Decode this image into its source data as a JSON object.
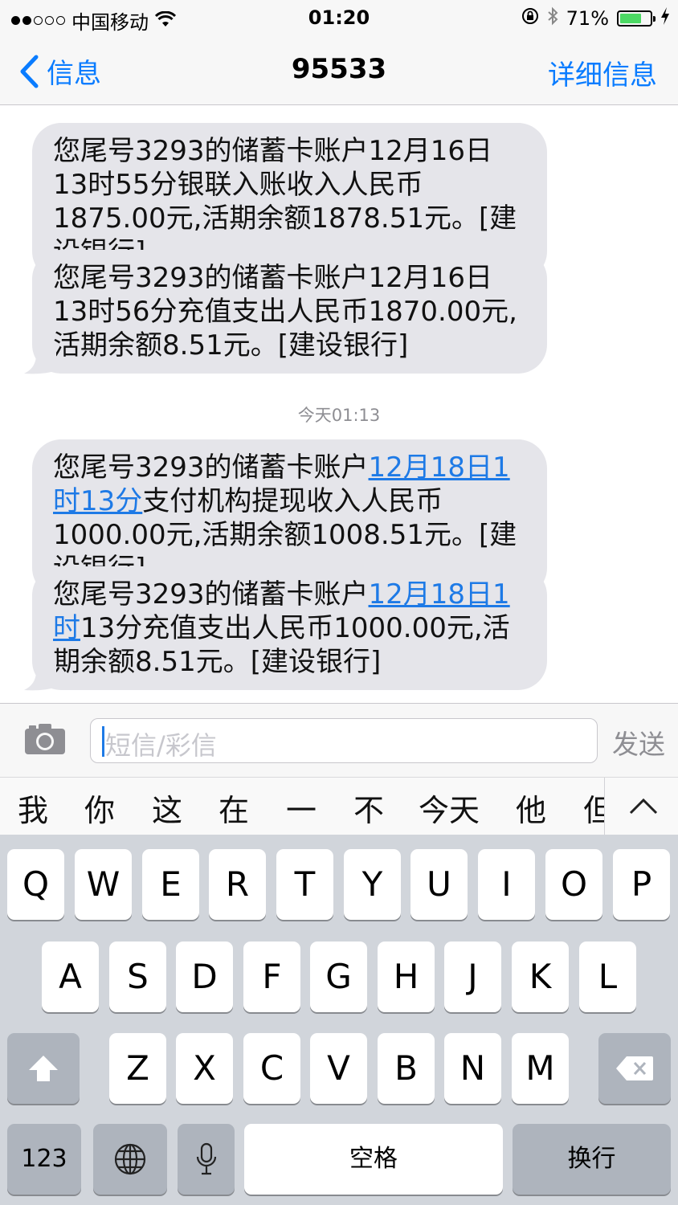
{
  "status_bar": {
    "carrier": "中国移动",
    "time": "01:20",
    "battery_percent": "71%",
    "battery_level": 0.71
  },
  "nav": {
    "back_label": "信息",
    "title": "95533",
    "detail_label": "详细信息"
  },
  "messages": [
    {
      "text": "您尾号3293的储蓄卡账户12月16日13时55分银联入账收入人民币1875.00元,活期余额1878.51元。[建设银行]"
    },
    {
      "text": "您尾号3293的储蓄卡账户12月16日13时56分充值支出人民币1870.00元,活期余额8.51元。[建设银行]"
    },
    {
      "prefix": "您尾号3293的储蓄卡账户",
      "link": "12月18日1时13分",
      "suffix": "支付机构提现收入人民币1000.00元,活期余额1008.51元。[建设银行]"
    },
    {
      "prefix": "您尾号3293的储蓄卡账户",
      "link": "12月18日1时",
      "suffix": "13分充值支出人民币1000.00元,活期余额8.51元。[建设银行]"
    }
  ],
  "timestamp_label": "今天01:13",
  "input": {
    "placeholder": "短信/彩信",
    "send_label": "发送"
  },
  "candidates": [
    "我",
    "你",
    "这",
    "在",
    "一",
    "不",
    "今天",
    "他",
    "但"
  ],
  "keyboard": {
    "row1": [
      "Q",
      "W",
      "E",
      "R",
      "T",
      "Y",
      "U",
      "I",
      "O",
      "P"
    ],
    "row2": [
      "A",
      "S",
      "D",
      "F",
      "G",
      "H",
      "J",
      "K",
      "L"
    ],
    "row3": [
      "Z",
      "X",
      "C",
      "V",
      "B",
      "N",
      "M"
    ],
    "numbers_label": "123",
    "space_label": "空格",
    "return_label": "换行"
  },
  "icons": [
    "signal-dots-icon",
    "wifi-icon",
    "rotation-lock-icon",
    "bluetooth-icon",
    "battery-icon",
    "charging-bolt-icon",
    "back-chevron-icon",
    "camera-icon",
    "chevron-up-icon",
    "shift-icon",
    "delete-icon",
    "globe-icon",
    "microphone-icon"
  ],
  "colors": {
    "accent": "#0a7cff",
    "bubble": "#e5e5ea",
    "battery": "#4cd964"
  }
}
